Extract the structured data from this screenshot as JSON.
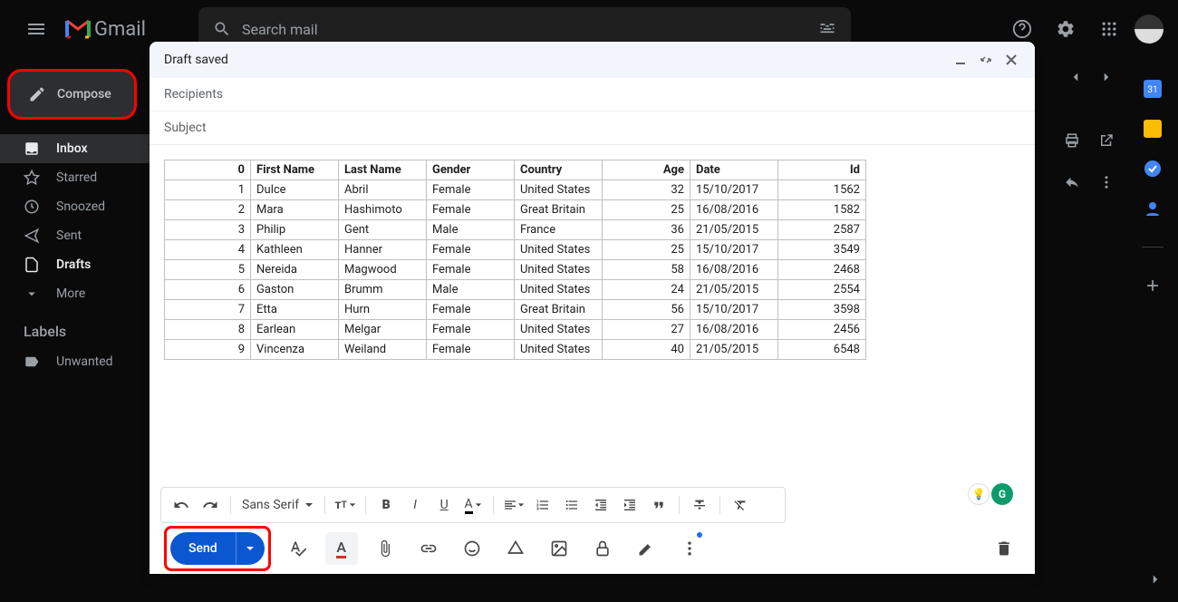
{
  "header": {
    "logo_text": "Gmail",
    "search_placeholder": "Search mail"
  },
  "sidebar": {
    "compose_label": "Compose",
    "items": [
      {
        "label": "Inbox",
        "icon": "inbox"
      },
      {
        "label": "Starred",
        "icon": "star"
      },
      {
        "label": "Snoozed",
        "icon": "clock"
      },
      {
        "label": "Sent",
        "icon": "send"
      },
      {
        "label": "Drafts",
        "icon": "file"
      },
      {
        "label": "More",
        "icon": "chevron"
      }
    ],
    "labels_header": "Labels",
    "labels": [
      {
        "label": "Unwanted"
      }
    ]
  },
  "compose": {
    "title": "Draft saved",
    "recipients_placeholder": "Recipients",
    "subject_placeholder": "Subject",
    "font_name": "Sans Serif",
    "send_label": "Send",
    "table": {
      "headers": [
        "0",
        "First Name",
        "Last Name",
        "Gender",
        "Country",
        "Age",
        "Date",
        "Id"
      ],
      "rows": [
        [
          "1",
          "Dulce",
          "Abril",
          "Female",
          "United States",
          "32",
          "15/10/2017",
          "1562"
        ],
        [
          "2",
          "Mara",
          "Hashimoto",
          "Female",
          "Great Britain",
          "25",
          "16/08/2016",
          "1582"
        ],
        [
          "3",
          "Philip",
          "Gent",
          "Male",
          "France",
          "36",
          "21/05/2015",
          "2587"
        ],
        [
          "4",
          "Kathleen",
          "Hanner",
          "Female",
          "United States",
          "25",
          "15/10/2017",
          "3549"
        ],
        [
          "5",
          "Nereida",
          "Magwood",
          "Female",
          "United States",
          "58",
          "16/08/2016",
          "2468"
        ],
        [
          "6",
          "Gaston",
          "Brumm",
          "Male",
          "United States",
          "24",
          "21/05/2015",
          "2554"
        ],
        [
          "7",
          "Etta",
          "Hurn",
          "Female",
          "Great Britain",
          "56",
          "15/10/2017",
          "3598"
        ],
        [
          "8",
          "Earlean",
          "Melgar",
          "Female",
          "United States",
          "27",
          "16/08/2016",
          "2456"
        ],
        [
          "9",
          "Vincenza",
          "Weiland",
          "Female",
          "United States",
          "40",
          "21/05/2015",
          "6548"
        ]
      ]
    }
  }
}
